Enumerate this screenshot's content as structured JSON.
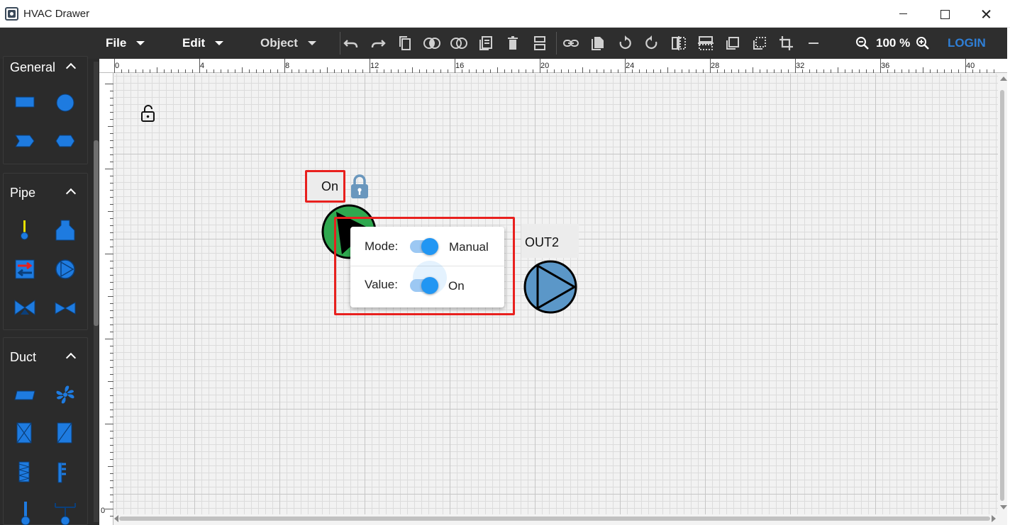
{
  "window": {
    "title": "HVAC Drawer"
  },
  "toolbar": {
    "menus": [
      {
        "label": "File"
      },
      {
        "label": "Edit"
      },
      {
        "label": "Object"
      }
    ],
    "zoom": "100 %",
    "login": "LOGIN",
    "icons": [
      "undo-icon",
      "redo-icon",
      "copy-icon",
      "union-icon",
      "intersect-icon",
      "paste-icon",
      "delete-icon",
      "align-icon",
      "link-icon",
      "duplicate-icon",
      "rotate-left-icon",
      "rotate-right-icon",
      "flip-horizontal-icon",
      "flip-vertical-icon",
      "bring-front-icon",
      "send-back-icon",
      "crop-icon",
      "line-icon",
      "zoom-out-icon",
      "zoom-in-icon"
    ]
  },
  "sidebar": {
    "panels": [
      {
        "title": "General"
      },
      {
        "title": "Pipe"
      },
      {
        "title": "Duct"
      }
    ]
  },
  "ruler": {
    "top_labels": [
      "0",
      "4",
      "8",
      "12",
      "16",
      "20",
      "24",
      "28",
      "32",
      "36",
      "40"
    ],
    "left_label": "0"
  },
  "canvas": {
    "pump_label": "On",
    "out_label": "OUT2",
    "popup": {
      "mode_label": "Mode:",
      "mode_value": "Manual",
      "value_label": "Value:",
      "value_value": "On"
    }
  },
  "colors": {
    "toolbar_bg": "#2e2e2e",
    "accent": "#2196f3",
    "login": "#2f7fd6",
    "highlight": "#e8201e",
    "pump_green": "#2fa84f",
    "out_blue": "#5b97c8",
    "shape_blue": "#1e7be0"
  }
}
